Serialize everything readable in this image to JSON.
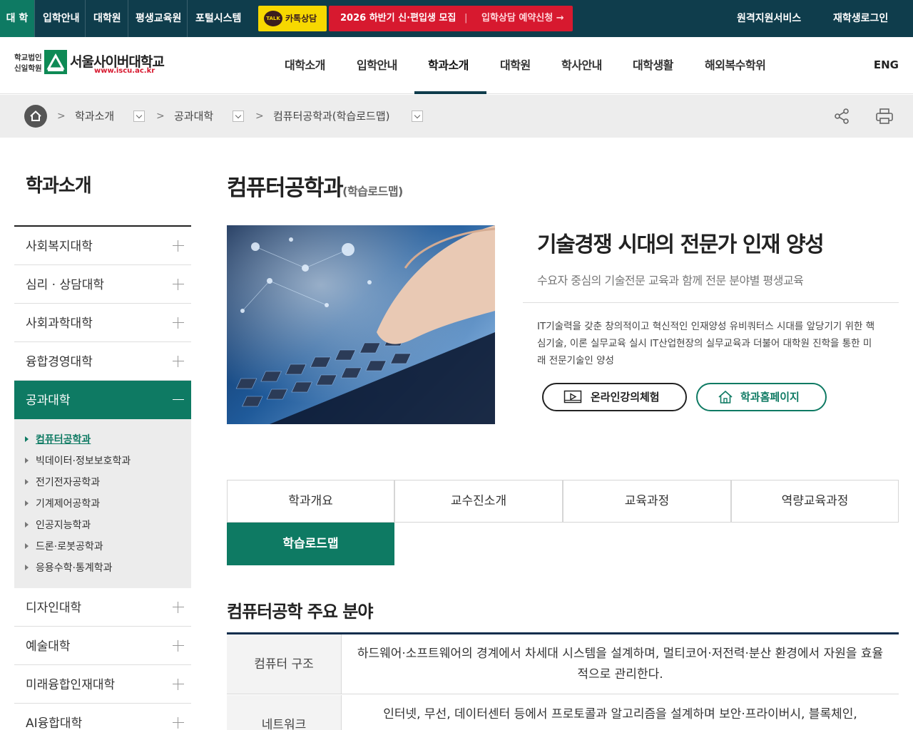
{
  "topbar": {
    "links": [
      "대 학",
      "입학안내",
      "대학원",
      "평생교육원",
      "포털시스템"
    ],
    "kakao_badge": "TALK",
    "kakao_label": "카톡상담",
    "promo_title": "2026 하반기 신·편입생 모집",
    "promo_divider": "|",
    "promo_cta": "입학상담 예약신청 →",
    "right_links": [
      "원격지원서비스",
      "재학생로그인"
    ]
  },
  "header": {
    "logo_corp_line1": "학교법인",
    "logo_corp_line2": "신일학원",
    "logo_name": "서울사이버대학교",
    "logo_url": "www.iscu.ac.kr",
    "menu": [
      "대학소개",
      "입학안내",
      "학과소개",
      "대학원",
      "학사안내",
      "대학생활",
      "해외복수학위"
    ],
    "active_menu": "학과소개",
    "lang": "ENG"
  },
  "breadcrumb": {
    "items": [
      "학과소개",
      "공과대학",
      "컴퓨터공학과(학습로드맵)"
    ],
    "separator": ">"
  },
  "sidebar": {
    "title": "학과소개",
    "items_top": [
      "사회복지대학",
      "심리 · 상담대학",
      "사회과학대학",
      "융합경영대학"
    ],
    "active_item": "공과대학",
    "sub_items": [
      "컴퓨터공학과",
      "빅데이터·정보보호학과",
      "전기전자공학과",
      "기계제어공학과",
      "인공지능학과",
      "드론·로봇공학과",
      "응용수학·통계학과"
    ],
    "items_bottom": [
      "디자인대학",
      "예술대학",
      "미래융합인재대학",
      "AI융합대학"
    ]
  },
  "main": {
    "title": "컴퓨터공학과",
    "title_sub": "(학습로드맵)",
    "slogan": "기술경쟁 시대의 전문가 인재 양성",
    "slogan_sub": "수요자 중심의 기술전문 교육과 함께 전문 분야별 평생교육",
    "intro": "IT기술력을 갖춘 창의적이고 혁신적인 인재양성 유비쿼터스 시대를 앞당기기 위한 핵심기술, 이론 실무교육 실시 IT산업현장의 실무교육과 더불어 대학원 진학을 통한 미래 전문기술인 양성",
    "btn_experience": "온라인강의체험",
    "btn_homepage": "학과홈페이지",
    "tabs": [
      "학과개요",
      "교수진소개",
      "교육과정",
      "역량교육과정",
      "학습로드맵"
    ],
    "active_tab": "학습로드맵",
    "section_title": "컴퓨터공학 주요 분야",
    "table": [
      {
        "head": "컴퓨터 구조",
        "body": "하드웨어·소프트웨어의 경계에서 차세대 시스템을 설계하며, 멀티코어·저전력·분산 환경에서 자원을 효율적으로 관리한다."
      },
      {
        "head": "네트워크",
        "body": "인터넷, 무선, 데이터센터 등에서 프로토콜과 알고리즘을 설계하며 보안·프라이버시, 블록체인,"
      }
    ]
  },
  "colors": {
    "topbar_bg": "#0f3d4c",
    "accent_green": "#0e7a63",
    "promo_red": "#d7192f",
    "kakao_yellow": "#f7d800"
  }
}
